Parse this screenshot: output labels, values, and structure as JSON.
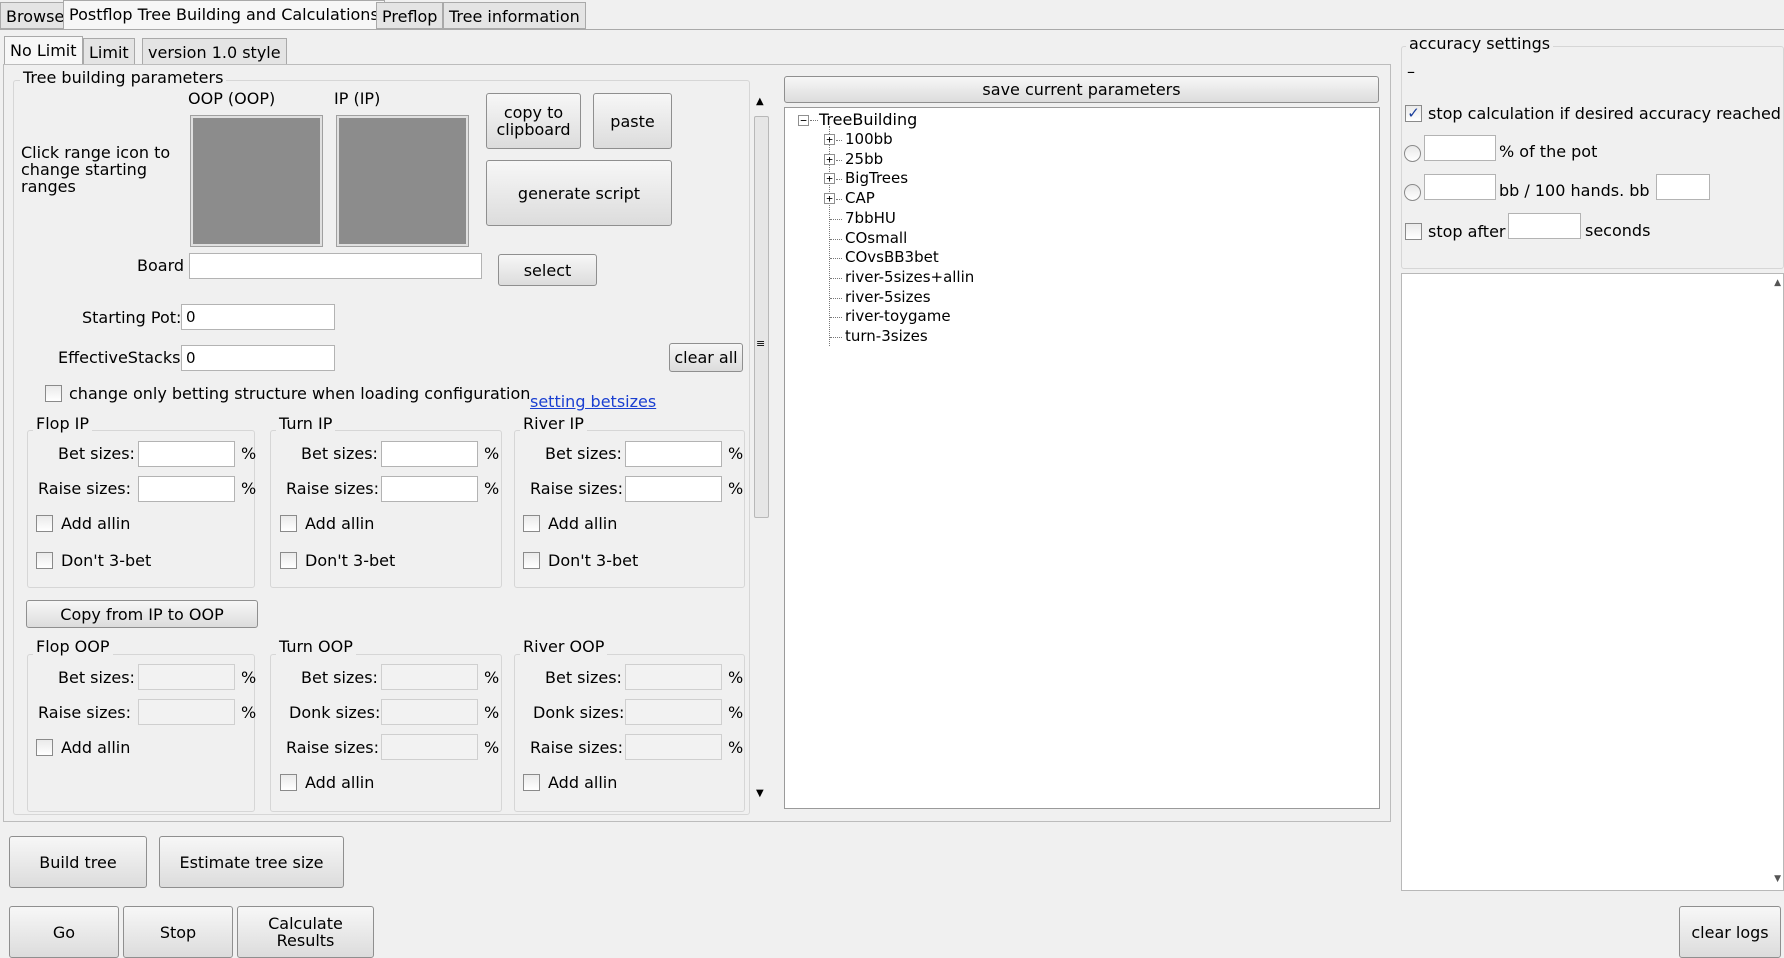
{
  "top_tabs": [
    "Browser",
    "Postflop Tree Building and Calculations",
    "Preflop",
    "Tree information"
  ],
  "sub_tabs": [
    "No Limit",
    "Limit",
    "version 1.0 style"
  ],
  "params": {
    "title": "Tree building parameters",
    "oop_label": "OOP (OOP)",
    "ip_label": "IP (IP)",
    "range_hint": "Click range icon to change starting ranges",
    "copy_clipboard": "copy to clipboard",
    "paste": "paste",
    "generate_script": "generate script",
    "board_label": "Board",
    "board_value": "",
    "select": "select",
    "starting_pot_label": "Starting Pot:",
    "starting_pot_value": "0",
    "effective_stacks_label": "EffectiveStacks",
    "effective_stacks_value": "0",
    "clear_all": "clear all",
    "change_only_label": "change only betting structure when loading configuration",
    "setting_betsizes": "setting betsizes",
    "copy_ip_to_oop": "Copy from IP to OOP"
  },
  "labels": {
    "bet_sizes": "Bet sizes:",
    "raise_sizes": "Raise sizes:",
    "donk_sizes": "Donk sizes:",
    "percent": "%",
    "add_allin": "Add allin",
    "dont_3bet": "Don't 3-bet"
  },
  "groups": {
    "flop_ip": "Flop IP",
    "turn_ip": "Turn IP",
    "river_ip": "River IP",
    "flop_oop": "Flop OOP",
    "turn_oop": "Turn OOP",
    "river_oop": "River OOP"
  },
  "save_params": "save current parameters",
  "tree": {
    "root": "TreeBuilding",
    "items": [
      {
        "label": "100bb",
        "expandable": true
      },
      {
        "label": "25bb",
        "expandable": true
      },
      {
        "label": "BigTrees",
        "expandable": true
      },
      {
        "label": "CAP",
        "expandable": true
      },
      {
        "label": "7bbHU",
        "expandable": false
      },
      {
        "label": "COsmall",
        "expandable": false
      },
      {
        "label": "COvsBB3bet",
        "expandable": false
      },
      {
        "label": "river-5sizes+allin",
        "expandable": false
      },
      {
        "label": "river-5sizes",
        "expandable": false
      },
      {
        "label": "river-toygame",
        "expandable": false
      },
      {
        "label": "turn-3sizes",
        "expandable": false
      }
    ]
  },
  "accuracy": {
    "title": "accuracy settings",
    "dash": "–",
    "stop_calc": "stop calculation if desired accuracy reached",
    "pct_pot": "% of the pot",
    "bb_hands": "bb / 100 hands. bb =",
    "stop_after": "stop after",
    "seconds": "seconds"
  },
  "bottom": {
    "build_tree": "Build tree",
    "estimate": "Estimate tree size",
    "go": "Go",
    "stop": "Stop",
    "calculate": "Calculate Results",
    "clear_logs": "clear logs"
  }
}
